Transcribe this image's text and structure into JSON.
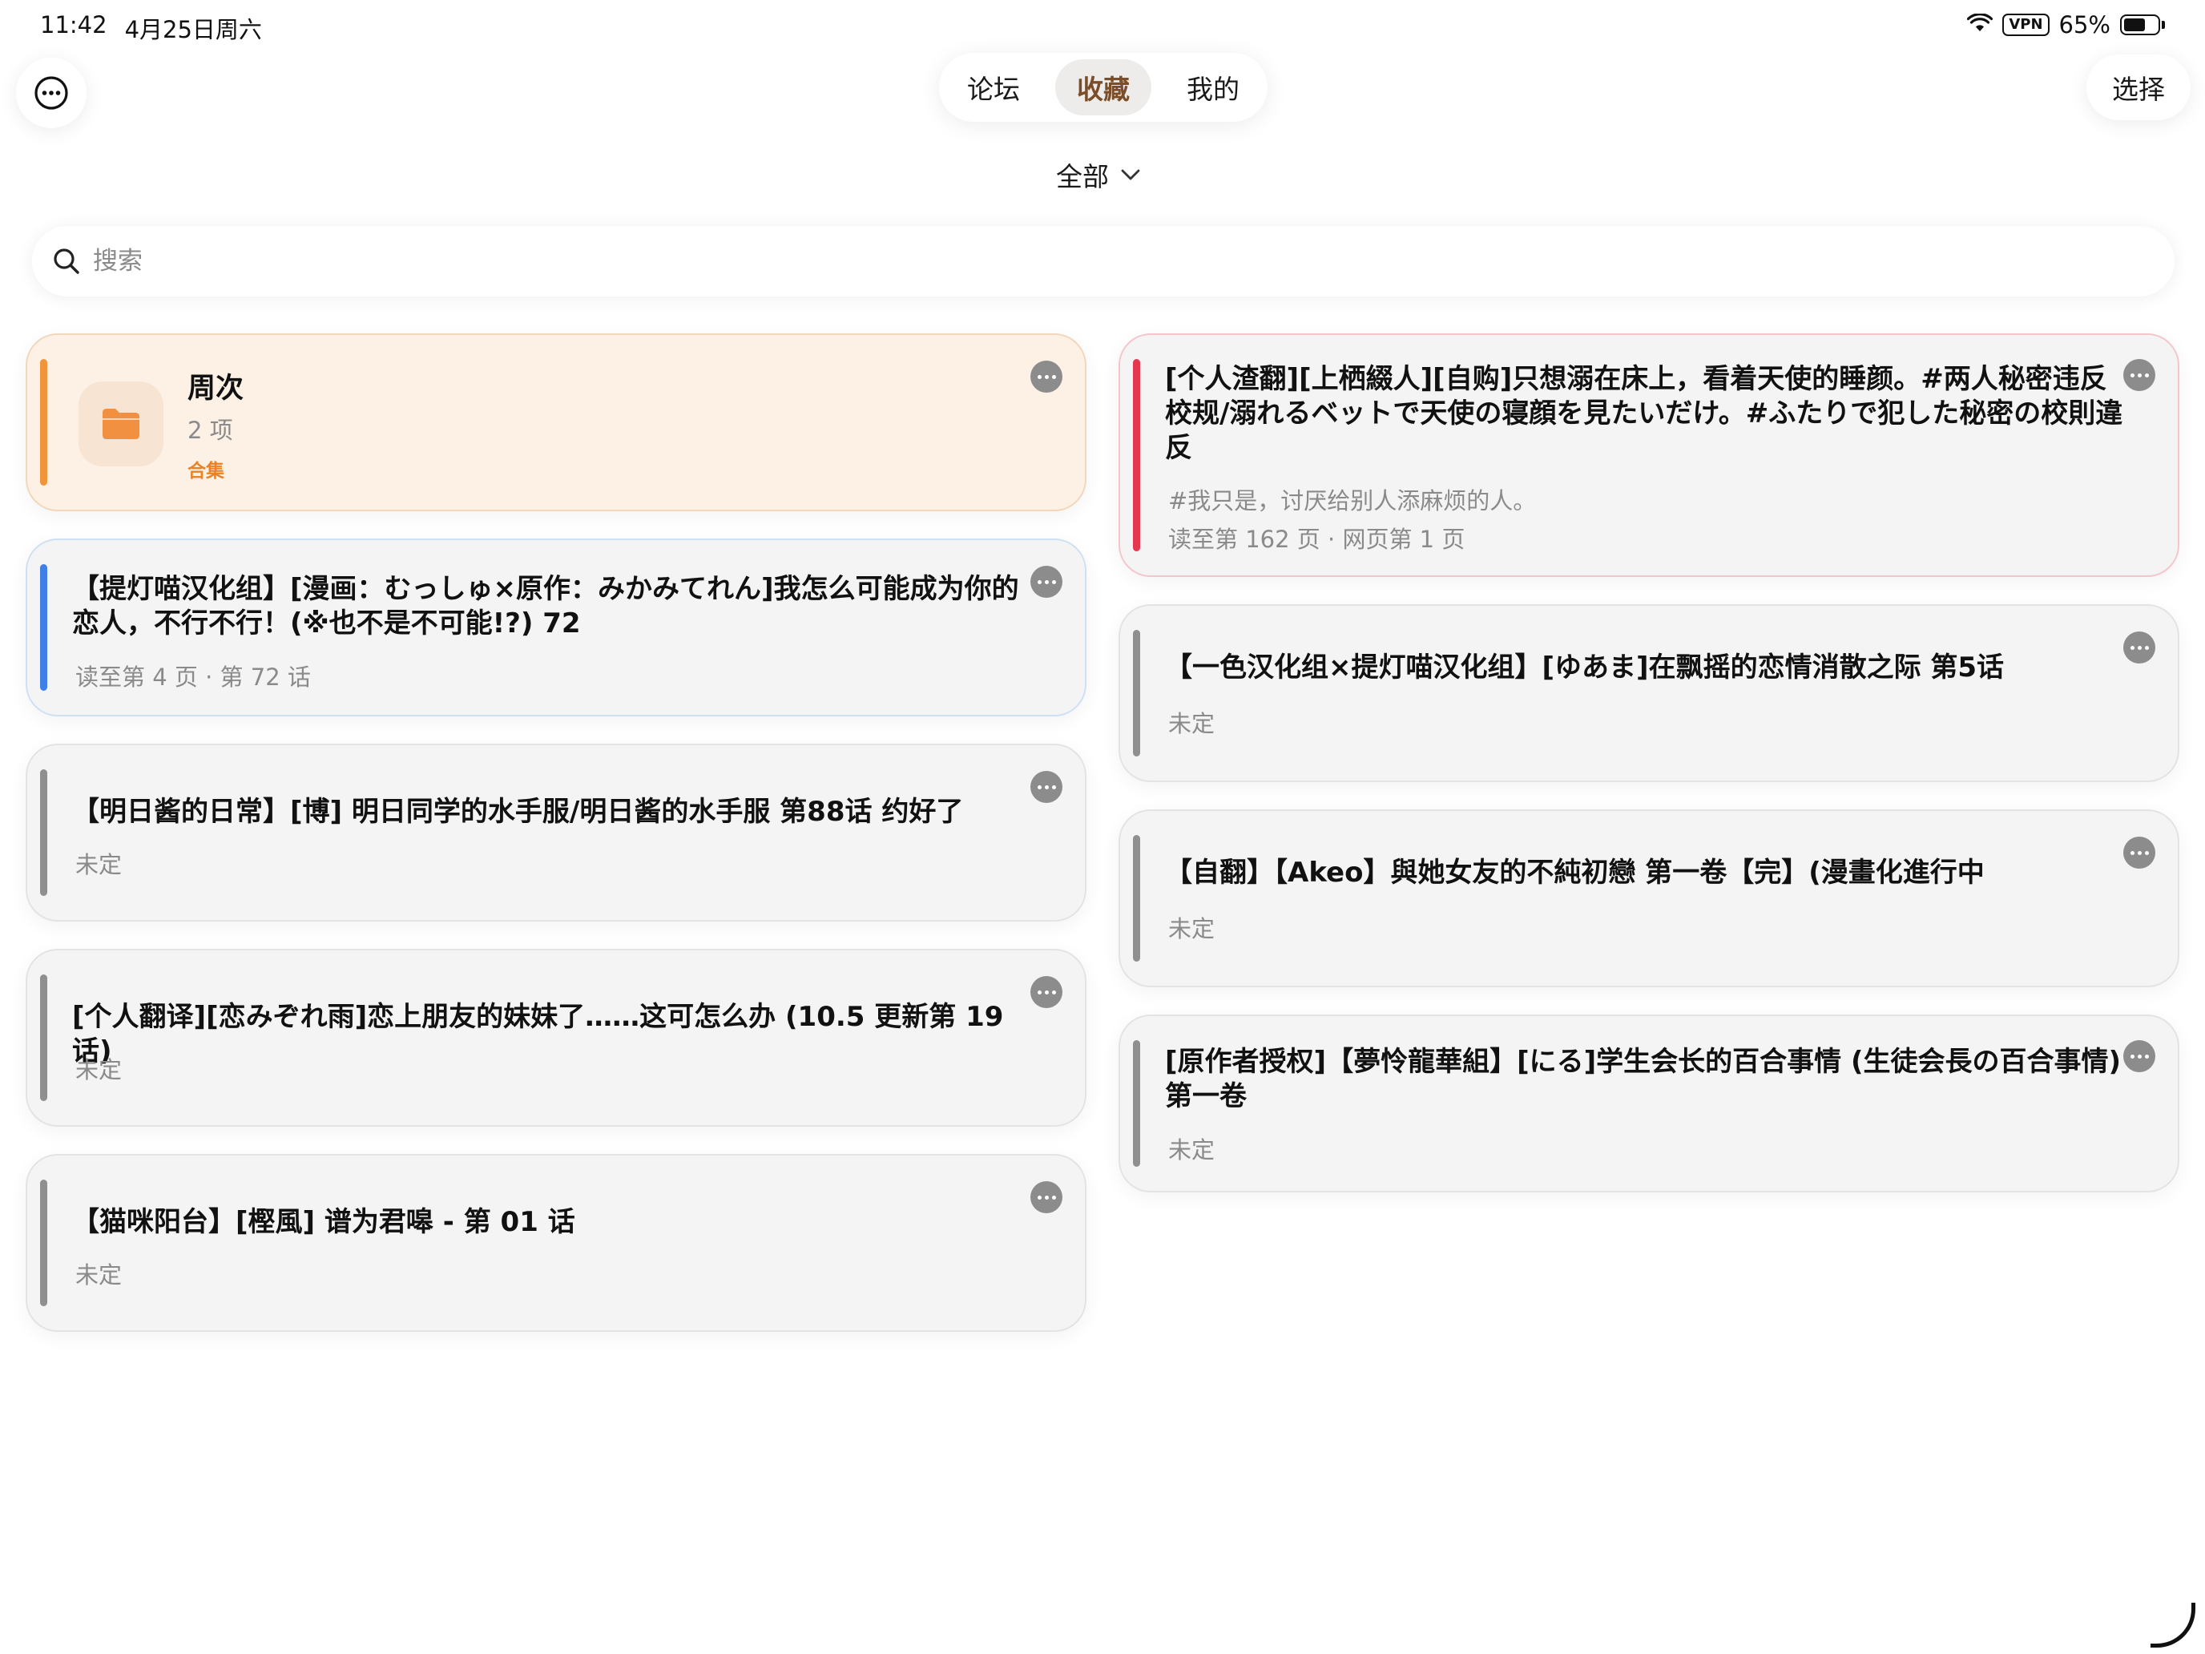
{
  "status_bar": {
    "time": "11:42",
    "date": "4月25日周六",
    "vpn": "VPN",
    "battery": "65%",
    "battery_level": 0.65
  },
  "tabs": [
    {
      "label": "论坛",
      "active": false
    },
    {
      "label": "收藏",
      "active": true
    },
    {
      "label": "我的",
      "active": false
    }
  ],
  "select_label": "选择",
  "filter": {
    "label": "全部"
  },
  "search": {
    "placeholder": "搜索"
  },
  "folder": {
    "name": "周次",
    "count": "2 项",
    "tag": "合集"
  },
  "left_cards": [
    {
      "title": "【提灯喵汉化组】[漫画：むっしゅ×原作：みかみてれん]我怎么可能成为你的恋人，不行不行！(※也不是不可能!?) 72",
      "meta": "读至第 4 页 · 第 72 话",
      "accent": "blue"
    },
    {
      "title": "【明日酱的日常】[博] 明日同学的水手服/明日酱的水手服 第88话 约好了",
      "meta": "未定",
      "accent": "gray"
    },
    {
      "title": "[个人翻译][恋みぞれ雨]恋上朋友的妹妹了……这可怎么办 (10.5 更新第 19 话)",
      "meta": "未定",
      "accent": "gray"
    },
    {
      "title": "【猫咪阳台】[樫風] 谱为君嗥 - 第 01 话",
      "meta": "未定",
      "accent": "gray"
    }
  ],
  "right_cards": [
    {
      "title": "[个人渣翻][上栖綴人][自购]只想溺在床上，看着天使的睡颜。#两人秘密违反校规/溺れるベットで天使の寝顔を見たいだけ。#ふたりで犯した秘密の校則違反",
      "subtitle": "#我只是，讨厌给别人添麻烦的人。",
      "meta": "读至第 162 页 · 网页第 1 页",
      "accent": "red"
    },
    {
      "title": "【一色汉化组×提灯喵汉化组】[ゆあま]在飘摇的恋情消散之际 第5话",
      "meta": "未定",
      "accent": "gray"
    },
    {
      "title": "【自翻】【Akeo】與她女友的不純初戀 第一卷【完】(漫畫化進行中",
      "meta": "未定",
      "accent": "gray"
    },
    {
      "title": "[原作者授权]【夢怜龍華組】[にる]学生会长的百合事情 (生徒会長の百合事情) 第一卷",
      "meta": "未定",
      "accent": "gray"
    }
  ],
  "colors": {
    "folder_accent": "#f0953c",
    "blue_accent": "#3f7fe6",
    "red_accent": "#e4384f",
    "gray_accent": "#8f8f8f",
    "active_tab_text": "#7a4e28"
  }
}
